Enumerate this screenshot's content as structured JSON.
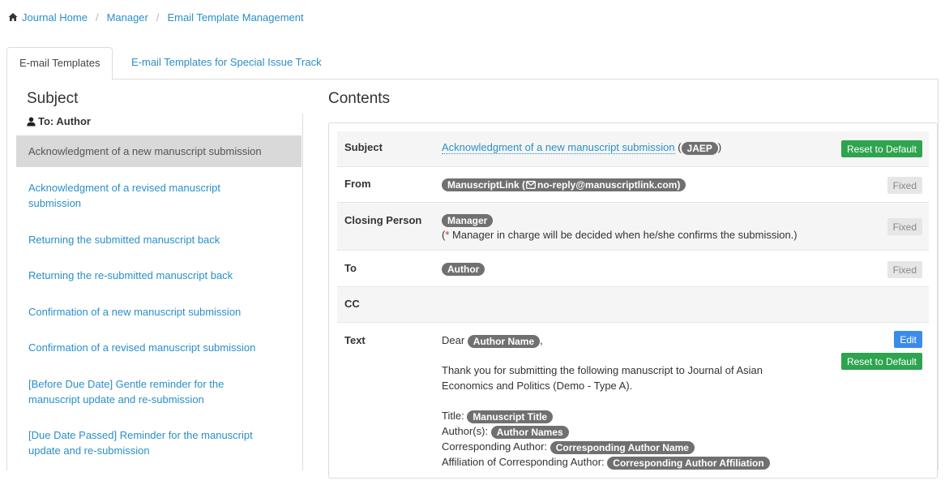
{
  "breadcrumb": {
    "home": "Journal Home",
    "manager": "Manager",
    "current": "Email Template Management"
  },
  "tabs": [
    {
      "label": "E-mail Templates"
    },
    {
      "label": "E-mail Templates for Special Issue Track"
    }
  ],
  "left": {
    "heading": "Subject",
    "to_label": "To: Author",
    "templates": [
      "Acknowledgment of a new manuscript submission",
      "Acknowledgment of a revised manuscript submission",
      "Returning the submitted manuscript back",
      "Returning the re-submitted manuscript back",
      "Confirmation of a new manuscript submission",
      "Confirmation of a revised manuscript submission",
      "[Before Due Date] Gentle reminder for the manuscript update and re-submission",
      "[Due Date Passed] Reminder for the manuscript update and re-submission"
    ]
  },
  "contents": {
    "heading": "Contents",
    "subject": {
      "label": "Subject",
      "link": "Acknowledgment of a new manuscript submission",
      "open_paren": " (",
      "badge": "JAEP",
      "close_paren": ")",
      "reset_button": "Reset to Default"
    },
    "from": {
      "label": "From",
      "badge_name": "ManuscriptLink (",
      "badge_email": "no-reply@manuscriptlink.com)",
      "fixed": "Fixed"
    },
    "closing": {
      "label": "Closing Person",
      "badge": "Manager",
      "note_open": "(",
      "note_star": "*",
      "note_text": " Manager in charge will be decided when he/she confirms the submission.)",
      "fixed": "Fixed"
    },
    "to": {
      "label": "To",
      "badge": "Author",
      "fixed": "Fixed"
    },
    "cc": {
      "label": "CC"
    },
    "text": {
      "label": "Text",
      "dear": "Dear ",
      "dear_badge": "Author Name",
      "dear_comma": ",",
      "para": "Thank you for submitting the following manuscript to Journal of Asian Economics and Politics (Demo - Type A).",
      "fields": [
        {
          "label": "Title: ",
          "badge": "Manuscript Title"
        },
        {
          "label": "Author(s): ",
          "badge": "Author Names"
        },
        {
          "label": "Corresponding Author: ",
          "badge": "Corresponding Author Name"
        },
        {
          "label": "Affiliation of Corresponding Author: ",
          "badge": "Corresponding Author Affiliation"
        }
      ],
      "edit_button": "Edit",
      "reset_button": "Reset to Default"
    }
  },
  "colors": {
    "link": "#2a8fc7",
    "badge": "#707070",
    "green": "#2ea44f",
    "blue": "#3b8ce8"
  }
}
